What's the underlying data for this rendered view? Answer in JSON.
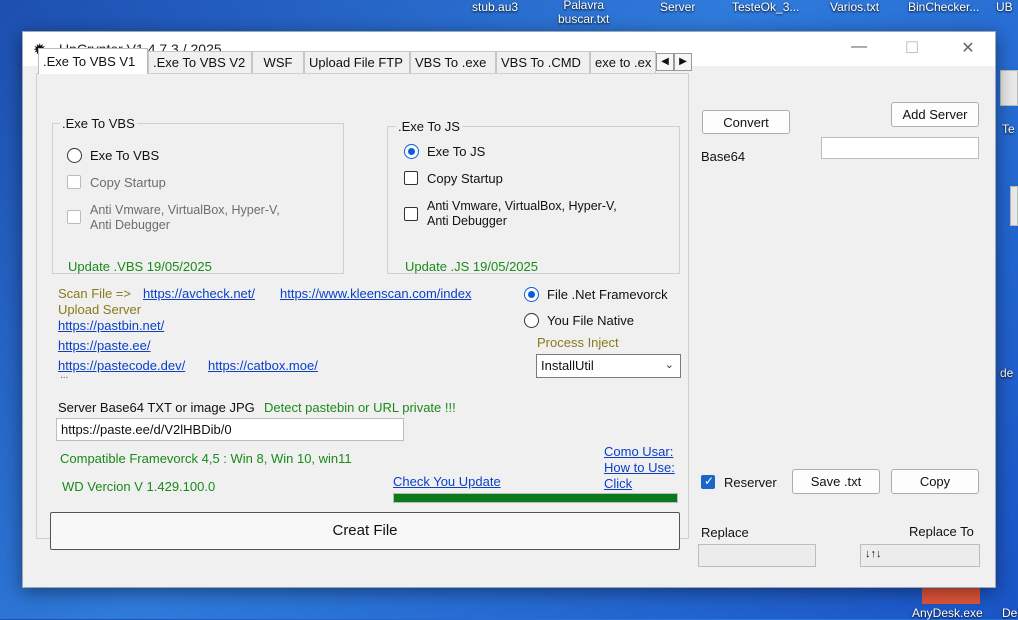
{
  "desktop": {
    "icons": [
      "stub.au3",
      "Palavra\nbuscar.txt",
      "Server",
      "TesteOk_3...",
      "Varios.txt",
      "BinChecker...",
      "UB",
      "Te",
      "de",
      "AnyDesk.exe",
      "De"
    ]
  },
  "window": {
    "title": "UpCrypter V1.4.7.3 / 2025",
    "controls": {
      "minimize": "—",
      "maximize": "☐",
      "close": "✕"
    }
  },
  "tabs": [
    {
      "label": ".Exe To VBS V1",
      "active": true
    },
    {
      "label": ".Exe To VBS V2",
      "active": false
    },
    {
      "label": "WSF",
      "active": false
    },
    {
      "label": "Upload File FTP",
      "active": false
    },
    {
      "label": "VBS To .exe",
      "active": false
    },
    {
      "label": "VBS To .CMD",
      "active": false
    },
    {
      "label": "exe to .ex",
      "active": false
    }
  ],
  "tab_scroll": {
    "left": "◀",
    "right": "▶"
  },
  "group_vbs": {
    "title": ".Exe To VBS",
    "radio_exe_to_vbs": "Exe To VBS",
    "copy_startup": "Copy Startup",
    "anti_line1": "Anti Vmware, VirtualBox, Hyper-V,",
    "anti_line2": "Anti Debugger",
    "update": "Update .VBS 19/05/2025"
  },
  "group_js": {
    "title": ".Exe To JS",
    "radio_exe_to_js": "Exe To JS",
    "copy_startup": "Copy Startup",
    "anti_line1": "Anti Vmware, VirtualBox, Hyper-V,",
    "anti_line2": "Anti Debugger",
    "update": "Update .JS 19/05/2025"
  },
  "scan": {
    "label": "Scan File =>",
    "link1": "https://avcheck.net/",
    "link2": "https://www.kleenscan.com/index"
  },
  "upload": {
    "label": "Upload Server",
    "link_pastebin": "https://pastbin.net/",
    "link_pasteee": "https://paste.ee/",
    "link_pastecode": "https://pastecode.dev/",
    "link_catbox": "https://catbox.moe/",
    "ellipsis": "..."
  },
  "framework": {
    "radio_net": "File .Net Framevorck",
    "radio_native": "You File Native",
    "process_inject_label": "Process Inject",
    "process_inject_value": "InstallUtil"
  },
  "server": {
    "label": "Server Base64 TXT or image JPG",
    "detect": "Detect pastebin or URL private !!!",
    "url": "https://paste.ee/d/V2lHBDib/0"
  },
  "compat": "Compatible Framevorck 4,5 : Win 8, Win 10, win11",
  "version": "WD Vercion V 1.429.100.0",
  "check_update": "Check You Update",
  "how_to": {
    "line1": "Como Usar:",
    "line2": "How to Use:",
    "line3": "Click"
  },
  "progress_percent": 100,
  "creat_file": "Creat File",
  "right": {
    "convert": "Convert",
    "add_server": "Add Server",
    "base64_label": "Base64",
    "reserver": "Reserver",
    "save_txt": "Save .txt",
    "copy": "Copy",
    "replace": "Replace",
    "replace_to": "Replace To",
    "replace_to_value": "↓↑↓"
  }
}
